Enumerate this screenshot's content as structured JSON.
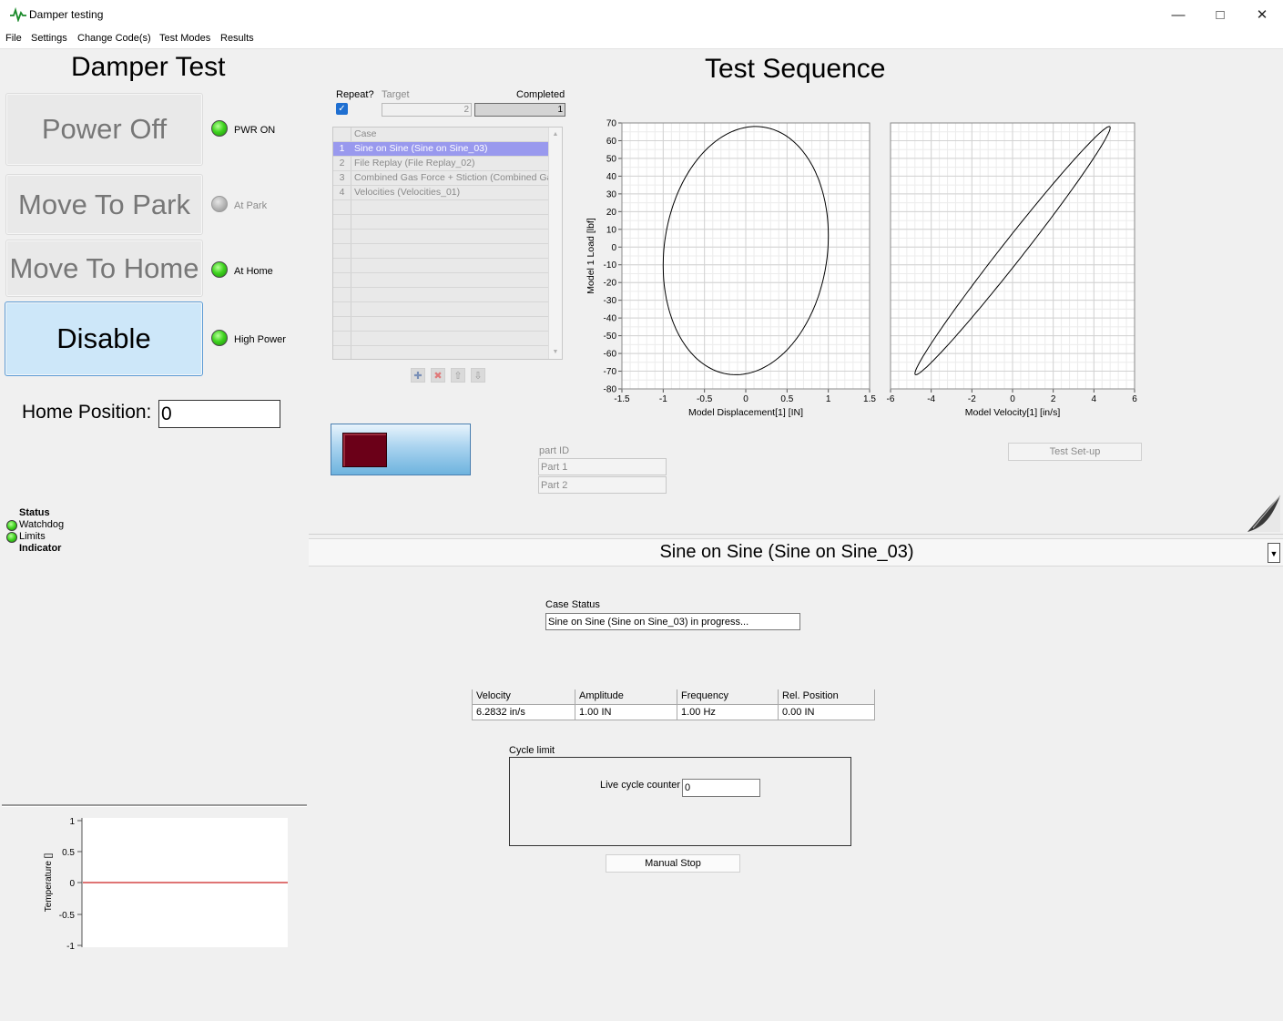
{
  "window": {
    "title": "Damper testing"
  },
  "menu": [
    "File",
    "Settings",
    "Change Code(s)",
    "Test Modes",
    "Results"
  ],
  "left": {
    "title": "Damper Test",
    "buttons": {
      "power": "Power Off",
      "park": "Move To Park",
      "home": "Move To Home",
      "disable": "Disable"
    },
    "leds": {
      "pwr_on": "PWR ON",
      "at_park": "At Park",
      "at_home": "At Home",
      "high_power": "High Power"
    },
    "home_position": {
      "label": "Home Position:",
      "value": "0"
    },
    "status": {
      "heading": "Status",
      "watchdog": "Watchdog",
      "limits": "Limits",
      "indicator": "Indicator"
    },
    "temp_chart": {
      "ylabel": "Temperature  []",
      "yticks": [
        "1",
        "0.5",
        "0",
        "-0.5",
        "-1"
      ]
    }
  },
  "sequence": {
    "title": "Test Sequence",
    "repeat_label": "Repeat?",
    "repeat_checked": true,
    "target_label": "Target",
    "target_value": "2",
    "completed_label": "Completed",
    "completed_value": "1",
    "list_header": "Case",
    "cases": [
      {
        "num": "1",
        "name": "Sine on Sine (Sine on Sine_03)"
      },
      {
        "num": "2",
        "name": "File Replay (File Replay_02)"
      },
      {
        "num": "3",
        "name": "Combined Gas Force + Stiction (Combined Gas"
      },
      {
        "num": "4",
        "name": "Velocities (Velocities_01)"
      }
    ],
    "part_id_label": "part ID",
    "parts": [
      "Part 1",
      "Part 2"
    ],
    "test_setup": "Test Set-up"
  },
  "current_case": "Sine on Sine (Sine on Sine_03)",
  "case_status": {
    "label": "Case Status",
    "value": "Sine on Sine (Sine on Sine_03) in progress..."
  },
  "params": [
    {
      "label": "Velocity",
      "value": "6.2832 in/s"
    },
    {
      "label": "Amplitude",
      "value": "1.00 IN"
    },
    {
      "label": "Frequency",
      "value": "1.00 Hz"
    },
    {
      "label": "Rel. Position",
      "value": "0.00 IN"
    }
  ],
  "cycle": {
    "label": "Cycle limit",
    "counter_label": "Live cycle counter",
    "counter_value": "0"
  },
  "manual_stop": "Manual Stop",
  "colors": {
    "led_on": "#3fd41f",
    "selected_row": "#9999ee",
    "disable_bg": "#cde7f9",
    "stop_red": "#6b0018",
    "temp_line": "#cc2222"
  },
  "chart_data": [
    {
      "type": "line",
      "xlabel": "Model Displacement[1]  [IN]",
      "ylabel": "Model 1 Load  [lbf]",
      "xlim": [
        -1.5,
        1.5
      ],
      "ylim": [
        -80,
        70
      ],
      "xticks": [
        -1.5,
        -1,
        -0.5,
        0,
        0.5,
        1,
        1.5
      ],
      "yticks": [
        70,
        60,
        50,
        40,
        30,
        20,
        10,
        0,
        -10,
        -20,
        -30,
        -40,
        -50,
        -60,
        -70,
        -80
      ],
      "grid": true,
      "series": [
        {
          "shape": "ellipse",
          "x_amplitude": 1.0,
          "x_center": 0.0,
          "y_peak": 68,
          "y_trough": -72
        }
      ]
    },
    {
      "type": "line",
      "xlabel": "Model Velocity[1]  [in/s]",
      "ylabel": "",
      "xlim": [
        -6,
        6
      ],
      "ylim": [
        -80,
        70
      ],
      "xticks": [
        -6,
        -4,
        -2,
        0,
        2,
        4,
        6
      ],
      "grid": true,
      "series": [
        {
          "shape": "ellipse",
          "x_amplitude": 4.8,
          "x_center": 0.0,
          "y_peak": 68,
          "y_trough": -72
        }
      ]
    },
    {
      "type": "line",
      "ylabel": "Temperature  []",
      "ylim": [
        -1,
        1
      ],
      "yticks": [
        1,
        0.5,
        0,
        -0.5,
        -1
      ],
      "series": [
        {
          "values": [
            0,
            0
          ]
        }
      ]
    }
  ]
}
